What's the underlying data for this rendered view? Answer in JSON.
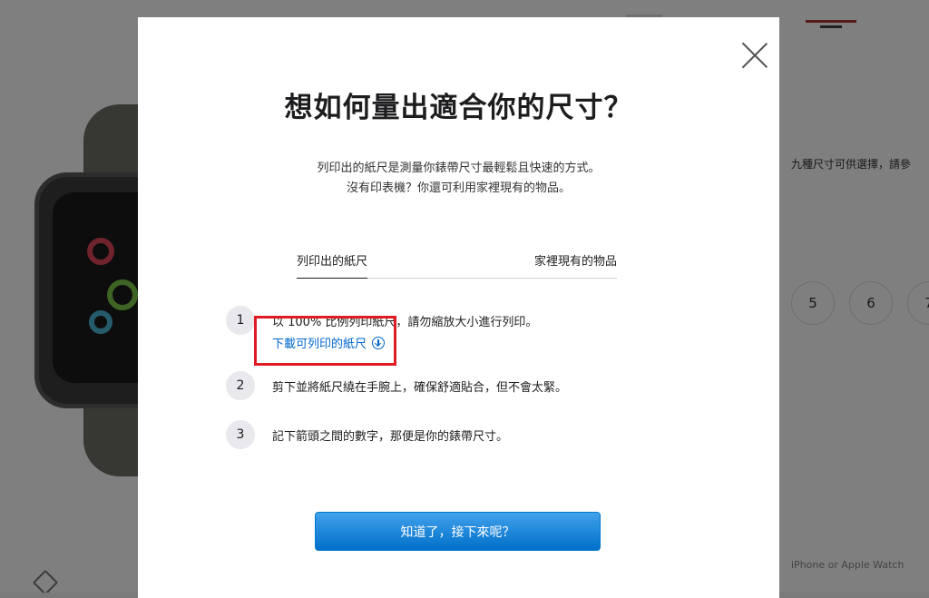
{
  "background": {
    "side_text": "九種尺寸可供選擇，請參",
    "size_options": [
      "5",
      "6",
      "7"
    ],
    "corner_text": "iPhone or Apple Watch"
  },
  "modal": {
    "title": "想如何量出適合你的尺寸？",
    "intro_line1": "列印出的紙尺是測量你錶帶尺寸最輕鬆且快速的方式。",
    "intro_line2": "沒有印表機？你還可利用家裡現有的物品。",
    "tabs": [
      {
        "label": "列印出的紙尺",
        "active": true
      },
      {
        "label": "家裡現有的物品",
        "active": false
      }
    ],
    "steps": [
      {
        "number": "1",
        "text": "以 100% 比例列印紙尺，請勿縮放大小進行列印。",
        "link": "下載可列印的紙尺"
      },
      {
        "number": "2",
        "text": "剪下並將紙尺繞在手腕上，確保舒適貼合，但不會太緊。"
      },
      {
        "number": "3",
        "text": "記下箭頭之間的數字，那便是你的錶帶尺寸。"
      }
    ],
    "cta_label": "知道了，接下來呢？",
    "close_icon": "close-icon",
    "download_icon": "download-circle-icon",
    "colors": {
      "link": "#0066cc",
      "cta": "#0070c9",
      "highlight": "#e01b24"
    }
  }
}
